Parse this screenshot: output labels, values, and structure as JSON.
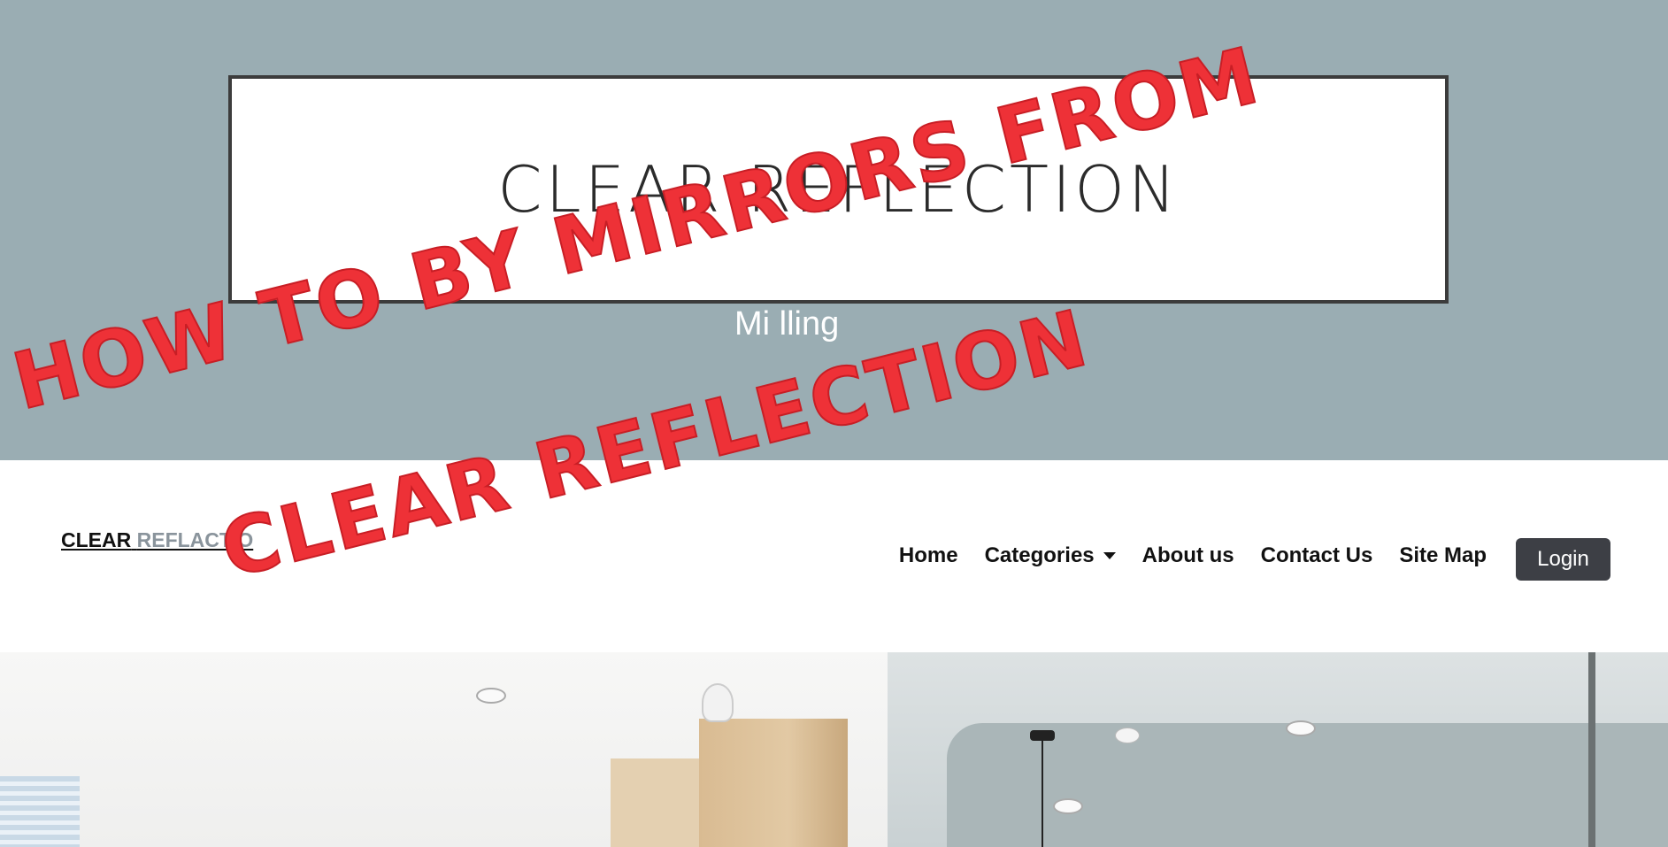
{
  "hero": {
    "logo_text": "CLEAR REFLECTION",
    "tagline": "Mi       lling"
  },
  "navbar": {
    "brand_part1": "CLEAR",
    "brand_part2": "REFLACTIO",
    "links": [
      "Home",
      "Categories",
      "About us",
      "Contact Us",
      "Site Map"
    ],
    "login_label": "Login"
  },
  "overlay": {
    "line1": "How to by mirrors from",
    "line2": "Clear Reflection"
  },
  "colors": {
    "hero_bg": "#9aadb3",
    "overlay_red": "#ee3137",
    "login_bg": "#3d3f45"
  }
}
